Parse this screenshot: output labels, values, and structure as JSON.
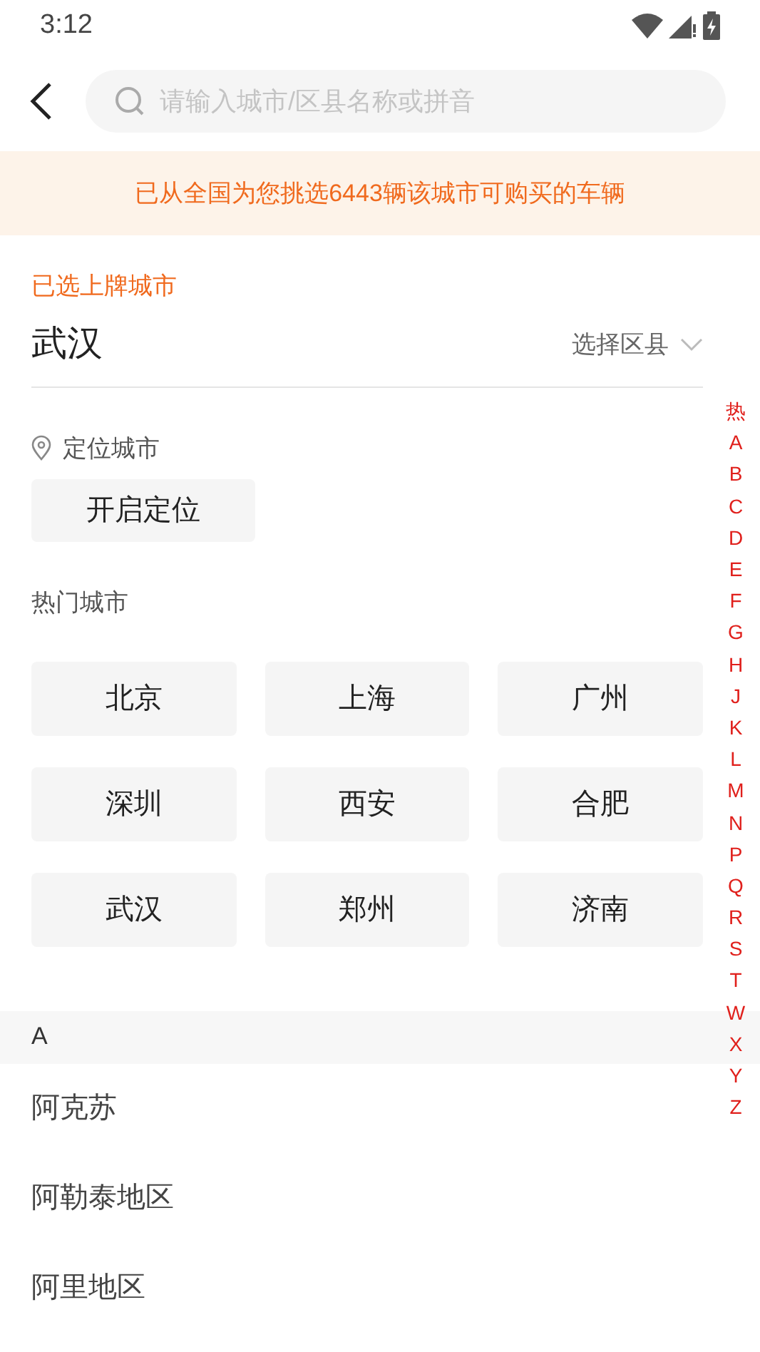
{
  "status_bar": {
    "time": "3:12"
  },
  "search": {
    "placeholder": "请输入城市/区县名称或拼音"
  },
  "banner": "已从全国为您挑选6443辆该城市可购买的车辆",
  "selected_city": {
    "heading": "已选上牌城市",
    "city": "武汉",
    "district_picker": "选择区县"
  },
  "location": {
    "heading": "定位城市",
    "button": "开启定位"
  },
  "hot_cities": {
    "heading": "热门城市",
    "cities": [
      "北京",
      "上海",
      "广州",
      "深圳",
      "西安",
      "合肥",
      "武汉",
      "郑州",
      "济南"
    ]
  },
  "sections": [
    {
      "letter": "A",
      "cities": [
        "阿克苏",
        "阿勒泰地区",
        "阿里地区"
      ]
    }
  ],
  "index_bar": [
    "热",
    "A",
    "B",
    "C",
    "D",
    "E",
    "F",
    "G",
    "H",
    "J",
    "K",
    "L",
    "M",
    "N",
    "P",
    "Q",
    "R",
    "S",
    "T",
    "W",
    "X",
    "Y",
    "Z"
  ]
}
